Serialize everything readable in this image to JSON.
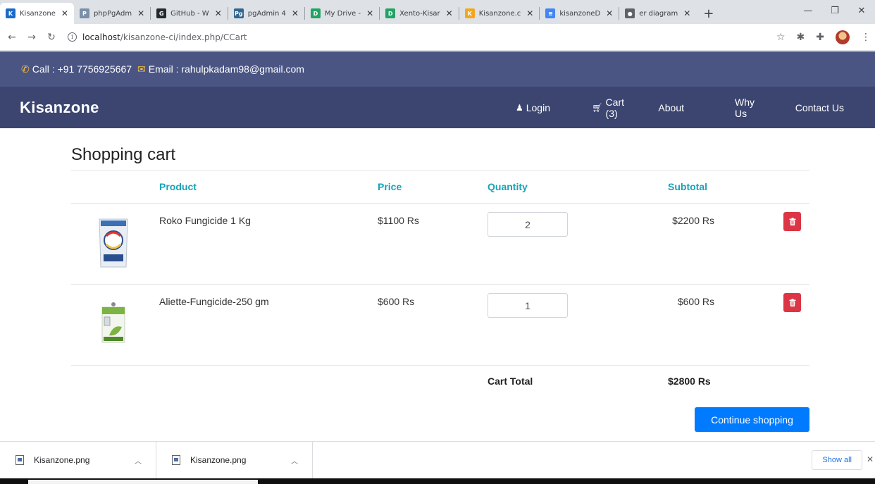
{
  "browser": {
    "tabs": [
      {
        "label": "Kisanzone",
        "color": "#1b6ac9",
        "glyph": "K",
        "active": true
      },
      {
        "label": "phpPgAdm",
        "color": "#7a8fa8",
        "glyph": "P",
        "active": false
      },
      {
        "label": "GitHub - W",
        "color": "#24292e",
        "glyph": "G",
        "active": false
      },
      {
        "label": "pgAdmin 4",
        "color": "#326690",
        "glyph": "Pg",
        "active": false
      },
      {
        "label": "My Drive -",
        "color": "#1fa463",
        "glyph": "D",
        "active": false
      },
      {
        "label": "Xento-Kisar",
        "color": "#1fa463",
        "glyph": "D",
        "active": false
      },
      {
        "label": "Kisanzone.c",
        "color": "#f4a61c",
        "glyph": "K",
        "active": false
      },
      {
        "label": "kisanzoneD",
        "color": "#4285f4",
        "glyph": "≡",
        "active": false
      },
      {
        "label": "er diagram",
        "color": "#5f6368",
        "glyph": "●",
        "active": false
      }
    ],
    "new_tab": "+",
    "url_host": "localhost",
    "url_path": "/kisanzone-ci/index.php/CCart"
  },
  "contact": {
    "call": "Call : +91 7756925667",
    "email": "Email : rahulpkadam98@gmail.com",
    "accent": "#f6c23e"
  },
  "nav": {
    "brand": "Kisanzone",
    "login": "Login",
    "cart": "Cart (3)",
    "about": "About",
    "why": "Why Us",
    "contact": "Contact Us"
  },
  "cart": {
    "title": "Shopping cart",
    "headers": {
      "product": "Product",
      "price": "Price",
      "quantity": "Quantity",
      "subtotal": "Subtotal"
    },
    "items": [
      {
        "name": "Roko Fungicide 1 Kg",
        "price": "$1100 Rs",
        "quantity": "2",
        "subtotal": "$2200 Rs"
      },
      {
        "name": "Aliette-Fungicide-250 gm",
        "price": "$600 Rs",
        "quantity": "1",
        "subtotal": "$600 Rs"
      }
    ],
    "total_label": "Cart Total",
    "total_value": "$2800 Rs",
    "continue_label": "Continue shopping"
  },
  "colors": {
    "header_accent": "#17a2b8",
    "danger": "#dc3545",
    "primary": "#007bff",
    "topbar": "#4a5584",
    "navbar": "#3b4570"
  },
  "downloads": {
    "files": [
      "Kisanzone.png",
      "Kisanzone.png"
    ],
    "show_all": "Show all"
  }
}
